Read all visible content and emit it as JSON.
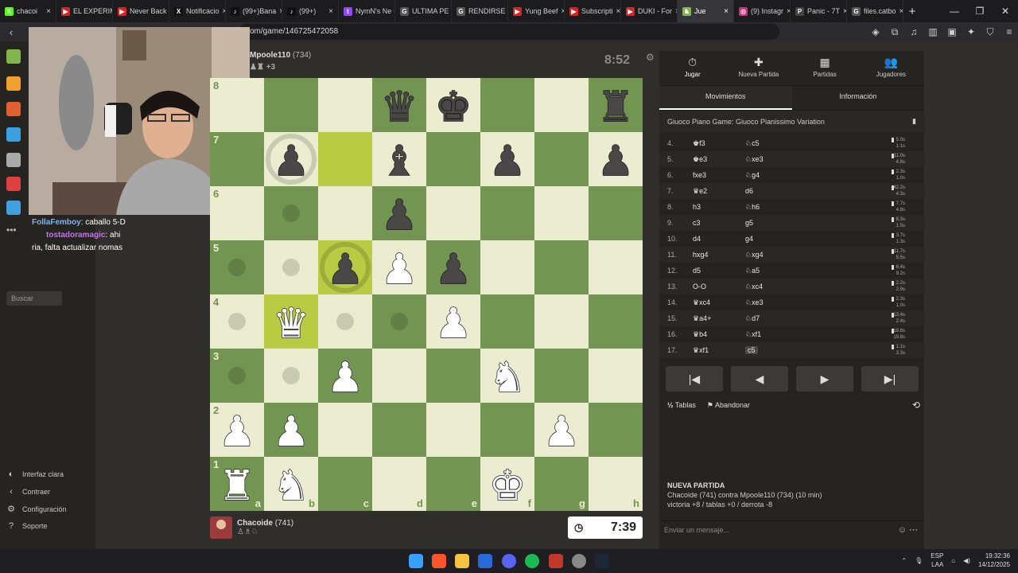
{
  "tabs": [
    {
      "label": "chacoi",
      "color": "#53fc18",
      "letter": "K"
    },
    {
      "label": "EL EXPERIM",
      "color": "#e02020",
      "letter": "▶"
    },
    {
      "label": "Never Back",
      "color": "#e02020",
      "letter": "▶"
    },
    {
      "label": "Notificacio",
      "color": "#111111",
      "letter": "X"
    },
    {
      "label": "(99+)Bana",
      "color": "#111111",
      "letter": "♪"
    },
    {
      "label": "(99+) ",
      "color": "#111111",
      "letter": "♪"
    },
    {
      "label": "NymN's Ne",
      "color": "#9146ff",
      "letter": "t"
    },
    {
      "label": "ULTIMA PE",
      "color": "#555555",
      "letter": "G"
    },
    {
      "label": "RENDIRSE",
      "color": "#555555",
      "letter": "G"
    },
    {
      "label": "Yung Beef",
      "color": "#e02020",
      "letter": "▶"
    },
    {
      "label": "Subscripti",
      "color": "#e02020",
      "letter": "▶"
    },
    {
      "label": "DUKI - For",
      "color": "#e02020",
      "letter": "▶"
    },
    {
      "label": "Jue",
      "color": "#81b64c",
      "letter": "♞",
      "active": true
    },
    {
      "label": "(9) Instagr",
      "color": "#d62976",
      "letter": "◎"
    },
    {
      "label": "Panic - 7T",
      "color": "#444444",
      "letter": "P"
    },
    {
      "label": "files.catbo",
      "color": "#555555",
      "letter": "G"
    }
  ],
  "url": "om/game/146725472058",
  "left_nav": {
    "search": "Buscar",
    "bottom": [
      {
        "icon": "◐",
        "label": "Interfaz clara"
      },
      {
        "icon": "‹",
        "label": "Contraer"
      },
      {
        "icon": "⚙",
        "label": "Configuración"
      },
      {
        "icon": "?",
        "label": "Soporte"
      }
    ]
  },
  "chat": [
    {
      "user": "FollaFemboy",
      "text": ": caballo 5-D"
    },
    {
      "user": "tostadoramagic",
      "text": ": ahi"
    },
    {
      "user": "",
      "text": "ria, falta actualizar nomas"
    }
  ],
  "opponent": {
    "name": "Mpoole110",
    "rating": "(734)",
    "extra": "+3",
    "clock": "8:52"
  },
  "player": {
    "name": "Chacoide",
    "rating": "(741)",
    "clock": "7:39"
  },
  "board": [
    [
      "",
      "",
      "",
      "bq",
      "bk",
      "",
      "",
      "br"
    ],
    [
      "",
      "bp",
      "",
      "bb",
      "",
      "bp",
      "",
      "bp"
    ],
    [
      "",
      "",
      "",
      "bp",
      "",
      "",
      "",
      ""
    ],
    [
      "",
      "",
      "bp",
      "wp",
      "bp",
      "",
      "",
      ""
    ],
    [
      "",
      "wq",
      "",
      "",
      "wp",
      "",
      "",
      ""
    ],
    [
      "",
      "",
      "wp",
      "",
      "",
      "wn",
      "",
      ""
    ],
    [
      "wp",
      "wp",
      "",
      "",
      "",
      "",
      "wp",
      ""
    ],
    [
      "wr",
      "wn",
      "",
      "",
      "",
      "wk",
      "",
      ""
    ]
  ],
  "highlight": [
    [
      1,
      2
    ],
    [
      3,
      2
    ],
    [
      4,
      1
    ]
  ],
  "dots": [
    [
      2,
      1
    ],
    [
      3,
      0
    ],
    [
      3,
      1
    ],
    [
      4,
      0
    ],
    [
      4,
      2
    ],
    [
      4,
      3
    ],
    [
      5,
      0
    ],
    [
      5,
      1
    ]
  ],
  "rings": [
    [
      1,
      1
    ],
    [
      3,
      2
    ]
  ],
  "ranks": [
    "8",
    "7",
    "6",
    "5",
    "4",
    "3",
    "2",
    "1"
  ],
  "files": [
    "a",
    "b",
    "c",
    "d",
    "e",
    "f",
    "g",
    "h"
  ],
  "panel": {
    "tabs": [
      {
        "icon": "⏱",
        "label": "Jugar"
      },
      {
        "icon": "✚",
        "label": "Nueva Partida"
      },
      {
        "icon": "▦",
        "label": "Partidas"
      },
      {
        "icon": "👥",
        "label": "Jugadores"
      }
    ],
    "subtabs": [
      "Movimientos",
      "Información"
    ],
    "opening": "Giuoco Piano Game: Giuoco Pianissimo Variation",
    "moves": [
      {
        "n": "4.",
        "w": "♚f3",
        "b": "♘c5",
        "tw": "5.0s",
        "tb": "1.1s"
      },
      {
        "n": "5.",
        "w": "♚e3",
        "b": "♘xe3",
        "tw": "11.0s",
        "tb": "4.8s"
      },
      {
        "n": "6.",
        "w": "fxe3",
        "b": "♘g4",
        "tw": "2.3s",
        "tb": "1.0s"
      },
      {
        "n": "7.",
        "w": "♛e2",
        "b": "d6",
        "tw": "42.2s",
        "tb": "4.3s"
      },
      {
        "n": "8.",
        "w": "h3",
        "b": "♘h6",
        "tw": "7.7s",
        "tb": "4.8s"
      },
      {
        "n": "9.",
        "w": "c3",
        "b": "g5",
        "tw": "8.3s",
        "tb": "1.5s"
      },
      {
        "n": "10.",
        "w": "d4",
        "b": "g4",
        "tw": "3.7s",
        "tb": "1.3s"
      },
      {
        "n": "11.",
        "w": "hxg4",
        "b": "♘xg4",
        "tw": "11.7s",
        "tb": "5.5s"
      },
      {
        "n": "12.",
        "w": "d5",
        "b": "♘a5",
        "tw": "6.4s",
        "tb": "9.2s"
      },
      {
        "n": "13.",
        "w": "O-O",
        "b": "♘xc4",
        "tw": "2.2s",
        "tb": "2.9s"
      },
      {
        "n": "14.",
        "w": "♛xc4",
        "b": "♘xe3",
        "tw": "2.3s",
        "tb": "1.0s"
      },
      {
        "n": "15.",
        "w": "♛a4+",
        "b": "♘d7",
        "tw": "13.4s",
        "tb": "2.4s"
      },
      {
        "n": "16.",
        "w": "♛b4",
        "b": "♘xf1",
        "tw": "19.8s",
        "tb": "19.8s"
      },
      {
        "n": "17.",
        "w": "♛xf1",
        "b": "c5",
        "tw": "1.1s",
        "tb": "3.3s"
      }
    ],
    "controls": [
      "|◀",
      "◀",
      "▶",
      "▶|"
    ],
    "draw": "Tablas",
    "resign": "Abandonar",
    "new_game_title": "NUEVA PARTIDA",
    "new_game_line1": "Chacoide (741) contra Mpoole110 (734) (10 min)",
    "new_game_line2": "victoria +8 / tablas +0 / derrota -8",
    "chat_placeholder": "Enviar un mensaje..."
  },
  "tray": {
    "lang": "ESP",
    "layout": "LAA",
    "time": "19:32:36",
    "date": "14/12/2025"
  }
}
